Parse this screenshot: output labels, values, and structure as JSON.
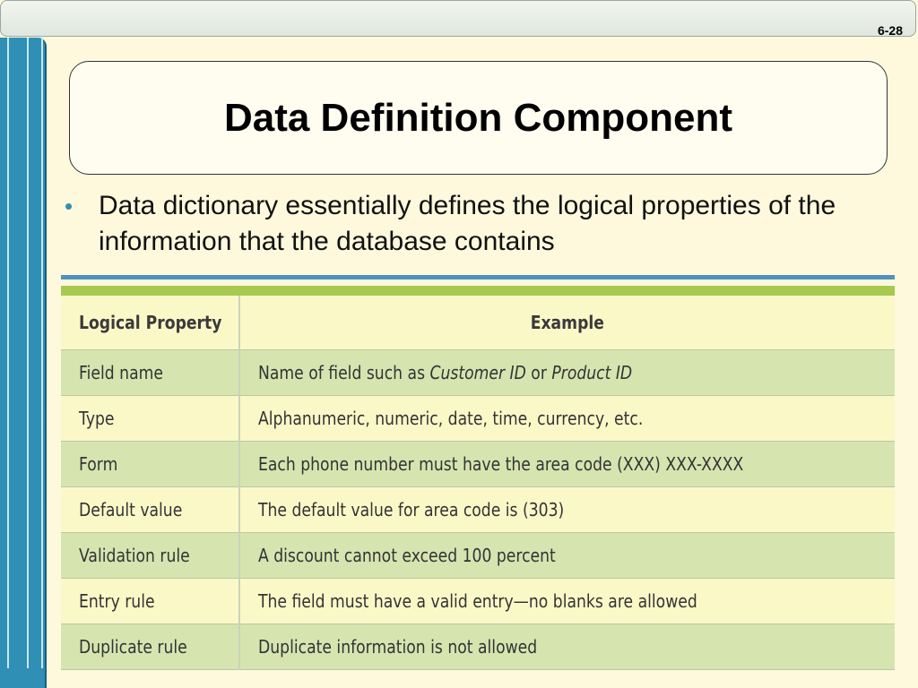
{
  "slide": {
    "number": "6-28",
    "title": "Data Definition Component",
    "bullet_text": "Data dictionary essentially defines the logical properties of the information that the database contains"
  },
  "table": {
    "headers": [
      "Logical Property",
      "Example"
    ],
    "rows": [
      {
        "property": "Field name",
        "example_pre": "Name of field such as ",
        "example_em1": "Customer ID",
        "example_mid": " or ",
        "example_em2": "Product ID"
      },
      {
        "property": "Type",
        "example": "Alphanumeric, numeric, date, time, currency, etc."
      },
      {
        "property": "Form",
        "example": "Each phone number must have the area code (XXX) XXX-XXXX"
      },
      {
        "property": "Default value",
        "example": "The default value for area code is (303)"
      },
      {
        "property": "Validation rule",
        "example": "A discount cannot exceed 100 percent"
      },
      {
        "property": "Entry rule",
        "example": "The field must have a valid entry—no blanks are allowed"
      },
      {
        "property": "Duplicate rule",
        "example": "Duplicate information is not allowed"
      }
    ]
  },
  "colors": {
    "background": "#fef9dd",
    "accent_blue": "#2f8fb4",
    "row_light": "#fbf8c8",
    "row_dark": "#d6e4b0",
    "rule_green": "#a7c94f"
  },
  "icons": {
    "bullet": "bullet-dot-icon"
  }
}
